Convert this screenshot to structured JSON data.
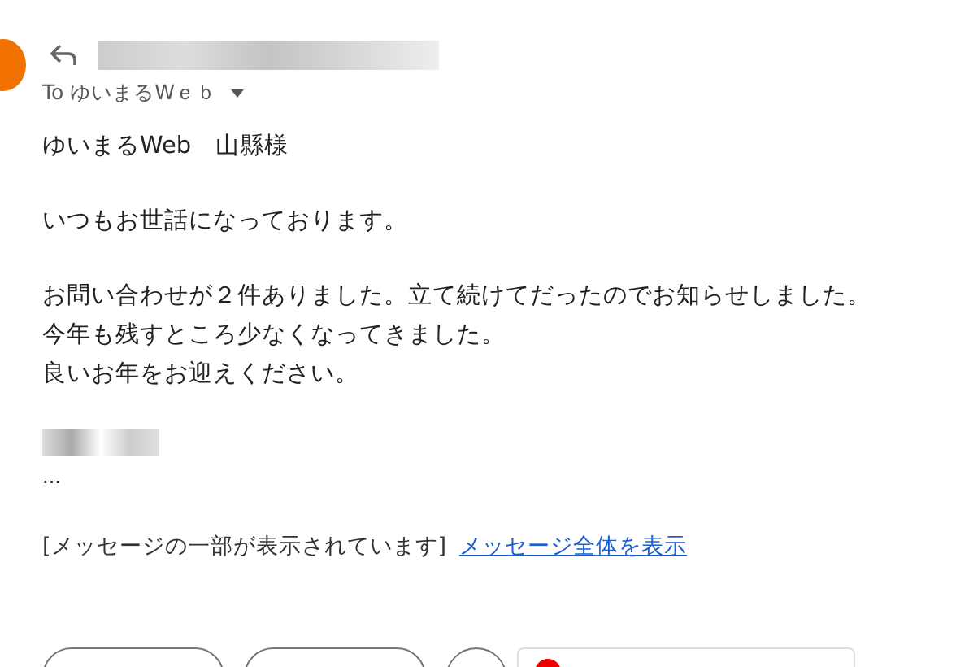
{
  "header": {
    "recipient_line": "To ゆいまるWｅｂ"
  },
  "body": {
    "paragraphs": [
      [
        "ゆいまるWeb　山縣様"
      ],
      [
        "いつもお世話になっております。"
      ],
      [
        "お問い合わせが２件ありました。立て続けてだったのでお知らせしました。",
        "今年も残すところ少なくなってきました。",
        "良いお年をお迎えください。"
      ]
    ],
    "ellipsis": "..."
  },
  "clipped_notice": {
    "text": "[メッセージの一部が表示されています]",
    "link": "メッセージ全体を表示"
  }
}
